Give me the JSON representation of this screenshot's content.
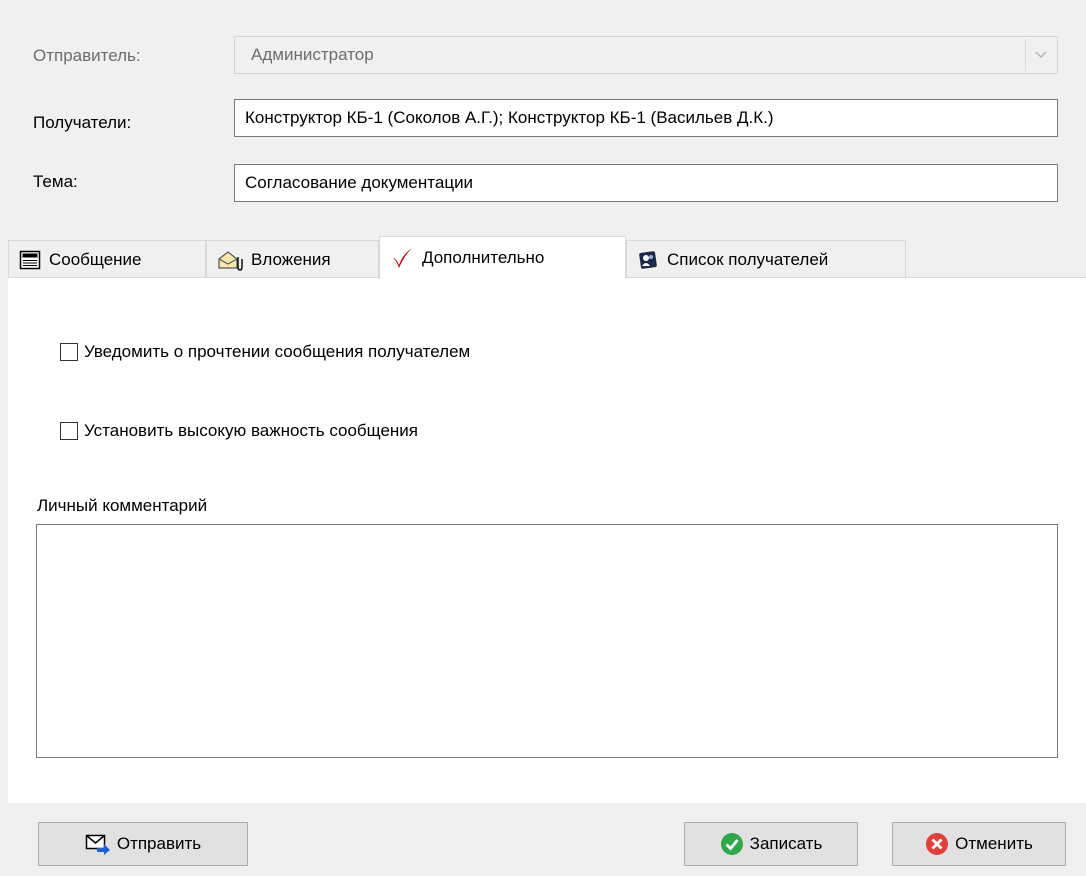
{
  "form": {
    "sender_label": "Отправитель:",
    "sender_value": "Администратор",
    "recipients_label": "Получатели:",
    "recipients_value": "Конструктор КБ-1 (Соколов А.Г.); Конструктор КБ-1 (Васильев Д.К.)",
    "subject_label": "Тема:",
    "subject_value": "Согласование документации"
  },
  "tabs": [
    {
      "label": "Сообщение",
      "icon": "message-icon"
    },
    {
      "label": "Вложения",
      "icon": "attachment-icon"
    },
    {
      "label": "Дополнительно",
      "icon": "checkmark-icon",
      "active": true
    },
    {
      "label": "Список получателей",
      "icon": "recipients-list-icon"
    }
  ],
  "options": {
    "read_receipt_label": "Уведомить о прочтении сообщения получателем",
    "read_receipt_checked": false,
    "high_importance_label": "Установить высокую важность сообщения",
    "high_importance_checked": false,
    "comment_label": "Личный комментарий",
    "comment_value": ""
  },
  "buttons": {
    "send": "Отправить",
    "save": "Записать",
    "cancel": "Отменить"
  },
  "colors": {
    "active_check": "#cc0000",
    "save_icon": "#2ea84a",
    "cancel_icon": "#e0403a",
    "send_icon": "#1f5fd6"
  }
}
